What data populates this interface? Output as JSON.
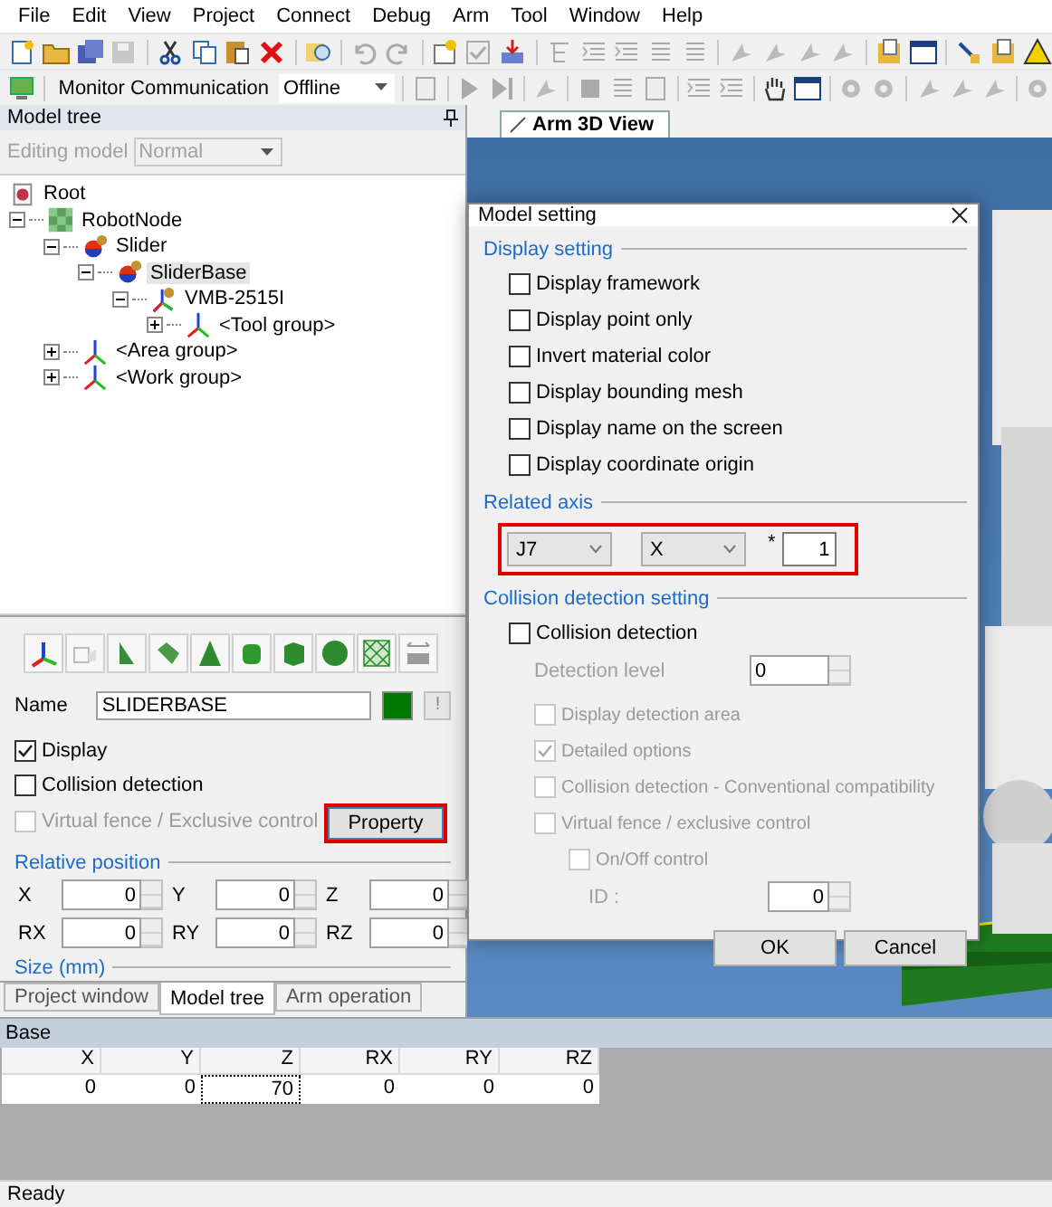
{
  "menu": [
    "File",
    "Edit",
    "View",
    "Project",
    "Connect",
    "Debug",
    "Arm",
    "Tool",
    "Window",
    "Help"
  ],
  "toolbar": {
    "comm_label": "Monitor Communication",
    "comm_value": "Offline"
  },
  "model_tree": {
    "title": "Model tree",
    "editing_model": {
      "label": "Editing model",
      "value": "Normal",
      "disabled": true
    },
    "nodes": [
      {
        "label": "Root",
        "kind": "root",
        "selected": false
      },
      {
        "label": "RobotNode",
        "kind": "robot",
        "selected": false,
        "expanded": true,
        "children": [
          {
            "label": "Slider",
            "kind": "part",
            "selected": false,
            "expanded": true,
            "children": [
              {
                "label": "SliderBase",
                "kind": "part",
                "selected": true,
                "expanded": true,
                "children": [
                  {
                    "label": "VMB-2515I",
                    "kind": "arm",
                    "selected": false,
                    "expanded": true,
                    "children": [
                      {
                        "label": "<Tool group>",
                        "kind": "group",
                        "selected": false,
                        "expanded": false
                      }
                    ]
                  }
                ]
              }
            ]
          },
          {
            "label": "<Area group>",
            "kind": "group",
            "selected": false,
            "expanded": false
          },
          {
            "label": "<Work group>",
            "kind": "group",
            "selected": false,
            "expanded": false
          }
        ]
      }
    ]
  },
  "properties": {
    "name_label": "Name",
    "name_value": "SLIDERBASE",
    "color": "#007800",
    "info_button": "!",
    "checks": [
      {
        "label": "Display",
        "checked": true,
        "disabled": false
      },
      {
        "label": "Collision detection",
        "checked": false,
        "disabled": false
      },
      {
        "label": "Virtual fence / Exclusive control",
        "checked": false,
        "disabled": true
      }
    ],
    "property_button": {
      "label": "Property",
      "highlighted": true
    },
    "relative_position": {
      "title": "Relative position",
      "fields": [
        {
          "label": "X",
          "value": "0"
        },
        {
          "label": "Y",
          "value": "0"
        },
        {
          "label": "Z",
          "value": "0"
        },
        {
          "label": "RX",
          "value": "0"
        },
        {
          "label": "RY",
          "value": "0"
        },
        {
          "label": "RZ",
          "value": "0"
        }
      ]
    },
    "size_title": "Size (mm)"
  },
  "left_tabs": [
    {
      "label": "Project window",
      "selected": false
    },
    {
      "label": "Model tree",
      "selected": true
    },
    {
      "label": "Arm operation",
      "selected": false
    }
  ],
  "view_tab": {
    "label": "Arm 3D View"
  },
  "dialog": {
    "title": "Model setting",
    "display_setting": {
      "title": "Display setting",
      "checks": [
        {
          "label": "Display framework",
          "checked": false
        },
        {
          "label": "Display point only",
          "checked": false
        },
        {
          "label": "Invert material color",
          "checked": false
        },
        {
          "label": "Display bounding mesh",
          "checked": false
        },
        {
          "label": "Display name on the screen",
          "checked": false
        },
        {
          "label": "Display coordinate origin",
          "checked": false
        }
      ]
    },
    "related_axis": {
      "title": "Related axis",
      "axis": "J7",
      "direction": "X",
      "multiplier_label": "*",
      "multiplier": "1",
      "highlighted": true
    },
    "collision": {
      "title": "Collision detection setting",
      "enable": {
        "label": "Collision detection",
        "checked": false
      },
      "level_label": "Detection level",
      "level_value": "0",
      "options": [
        {
          "label": "Display detection area",
          "checked": false,
          "disabled": true
        },
        {
          "label": "Detailed options",
          "checked": true,
          "disabled": true
        },
        {
          "label": "Collision detection - Conventional compatibility",
          "checked": false,
          "disabled": true
        },
        {
          "label": "Virtual fence / exclusive control",
          "checked": false,
          "disabled": true,
          "children": [
            {
              "label": "On/Off control",
              "checked": false,
              "disabled": true
            }
          ]
        }
      ],
      "id_label": "ID :",
      "id_value": "0"
    },
    "buttons": [
      "OK",
      "Cancel"
    ]
  },
  "base_panel": {
    "title": "Base",
    "columns": [
      "X",
      "Y",
      "Z",
      "RX",
      "RY",
      "RZ"
    ],
    "rows": [
      {
        "cells": [
          {
            "value": "0",
            "focused": false
          },
          {
            "value": "0",
            "focused": false
          },
          {
            "value": "70",
            "focused": true
          },
          {
            "value": "0",
            "focused": false
          },
          {
            "value": "0",
            "focused": false
          },
          {
            "value": "0",
            "focused": false
          }
        ]
      }
    ]
  },
  "status_bar": "Ready"
}
